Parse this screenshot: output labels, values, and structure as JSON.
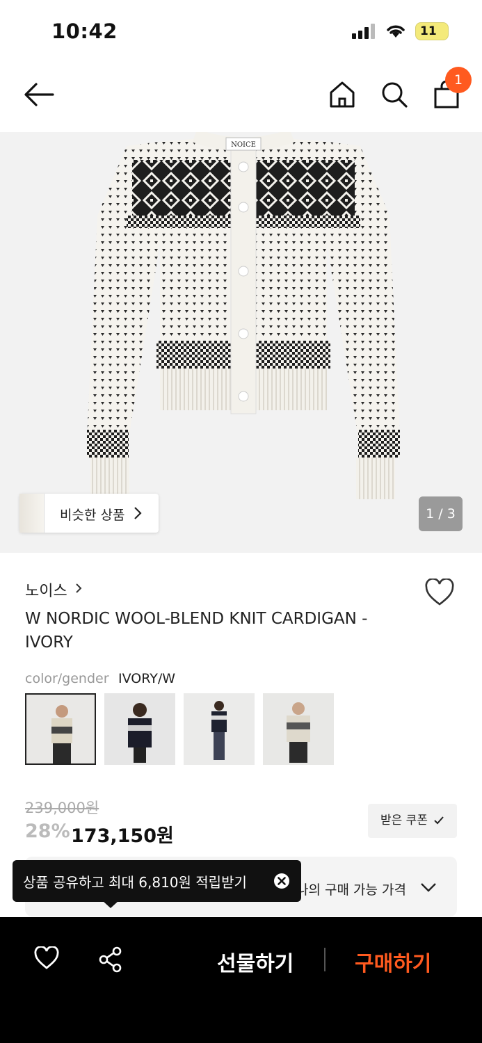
{
  "status_bar": {
    "time": "10:42",
    "battery": "11"
  },
  "header": {
    "cart_count": "1"
  },
  "hero": {
    "similar_label": "비슷한 상품",
    "image_counter": "1 / 3",
    "sweater_label": "NOICE"
  },
  "product": {
    "brand": "노이스",
    "title": "W NORDIC WOOL-BLEND KNIT CARDIGAN - IVORY",
    "option_label": "color/gender",
    "option_value": "IVORY/W",
    "original_price": "239,000원",
    "discount": "28%",
    "price": "173,150원",
    "coupon_label": "받은 쿠폰",
    "my_price_label": "나의 구매 가능 가격"
  },
  "tooltip": {
    "text": "상품 공유하고 최대 6,810원 적립받기"
  },
  "bottom_bar": {
    "gift_label": "선물하기",
    "buy_label": "구매하기"
  },
  "colors": {
    "accent": "#ff5a1f",
    "hero_bg": "#f2f2f2",
    "bar_bg": "#000000"
  }
}
